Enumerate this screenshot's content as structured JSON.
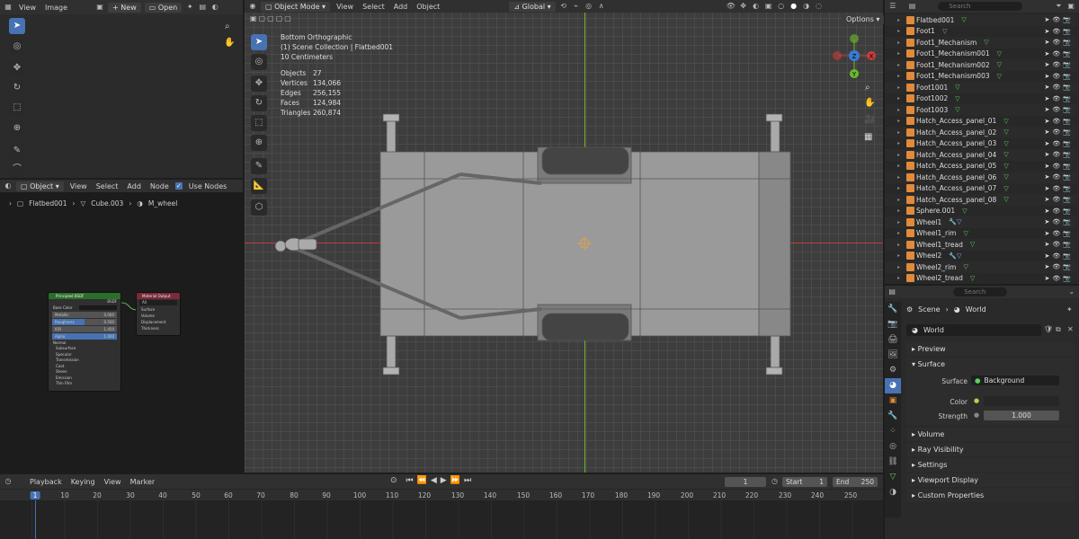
{
  "image_editor": {
    "menu": [
      "View",
      "Image"
    ],
    "new_label": "New",
    "open_label": "Open"
  },
  "viewport": {
    "mode_label": "Object Mode",
    "menu": [
      "View",
      "Select",
      "Add",
      "Object"
    ],
    "transform_label": "Global",
    "options_label": "Options",
    "view_name": "Bottom Orthographic",
    "collection_line": "(1) Scene Collection | Flatbed001",
    "scale_line": "10 Centimeters",
    "stats": [
      {
        "label": "Objects",
        "value": "27"
      },
      {
        "label": "Vertices",
        "value": "134,066"
      },
      {
        "label": "Edges",
        "value": "256,155"
      },
      {
        "label": "Faces",
        "value": "124,984"
      },
      {
        "label": "Triangles",
        "value": "260,874"
      }
    ]
  },
  "node_editor": {
    "mode_label": "Object",
    "menu": [
      "View",
      "Select",
      "Add",
      "Node"
    ],
    "use_nodes_label": "Use Nodes",
    "breadcrumb": [
      "Flatbed001",
      "Cube.003",
      "M_wheel"
    ],
    "bsdf_title": "Principled BSDF",
    "bsdf_sub": "BSDF",
    "bsdf_rows": [
      {
        "label": "Base Color",
        "value": ""
      },
      {
        "label": "Metallic",
        "value": "0.000"
      },
      {
        "label": "Roughness",
        "value": "0.500"
      },
      {
        "label": "IOR",
        "value": "1.450"
      },
      {
        "label": "Alpha",
        "value": "1.000"
      }
    ],
    "bsdf_normal": "Normal",
    "bsdf_subpanels": [
      "Subsurface",
      "Specular",
      "Transmission",
      "Coat",
      "Sheen",
      "Emission",
      "Thin Film"
    ],
    "output_title": "Material Output",
    "output_target": "All",
    "output_inputs": [
      "Surface",
      "Volume",
      "Displacement",
      "Thickness"
    ]
  },
  "outliner": {
    "search_placeholder": "Search",
    "items": [
      "Flatbed001",
      "Foot1",
      "Foot1_Mechanism",
      "Foot1_Mechanism001",
      "Foot1_Mechanism002",
      "Foot1_Mechanism003",
      "Foot1001",
      "Foot1002",
      "Foot1003",
      "Hatch_Access_panel_01",
      "Hatch_Access_panel_02",
      "Hatch_Access_panel_03",
      "Hatch_Access_panel_04",
      "Hatch_Access_panel_05",
      "Hatch_Access_panel_06",
      "Hatch_Access_panel_07",
      "Hatch_Access_panel_08",
      "Sphere.001",
      "Wheel1",
      "Wheel1_rim",
      "Wheel1_tread",
      "Wheel2",
      "Wheel2_rim",
      "Wheel2_tread"
    ]
  },
  "properties": {
    "search_placeholder": "Search",
    "breadcrumb_scene": "Scene",
    "breadcrumb_world": "World",
    "world_name": "World",
    "sections": {
      "preview": "Preview",
      "surface": "Surface",
      "volume": "Volume",
      "ray_visibility": "Ray Visibility",
      "settings": "Settings",
      "viewport_display": "Viewport Display",
      "custom_properties": "Custom Properties"
    },
    "surface_label": "Surface",
    "surface_value": "Background",
    "color_label": "Color",
    "strength_label": "Strength",
    "strength_value": "1.000"
  },
  "timeline": {
    "menu": [
      "Playback",
      "Keying",
      "View",
      "Marker"
    ],
    "current_frame": "1",
    "start_label": "Start",
    "start_value": "1",
    "end_label": "End",
    "end_value": "250",
    "ticks": [
      "1",
      "10",
      "20",
      "30",
      "40",
      "50",
      "60",
      "70",
      "80",
      "90",
      "100",
      "110",
      "120",
      "130",
      "140",
      "150",
      "160",
      "170",
      "180",
      "190",
      "200",
      "210",
      "220",
      "230",
      "240",
      "250"
    ]
  },
  "colors": {
    "accent": "#4772b3",
    "x_axis": "#c83c3c",
    "y_axis": "#6fb92c",
    "z_axis": "#3a7bd5",
    "mesh_orange": "#e08a3a"
  }
}
